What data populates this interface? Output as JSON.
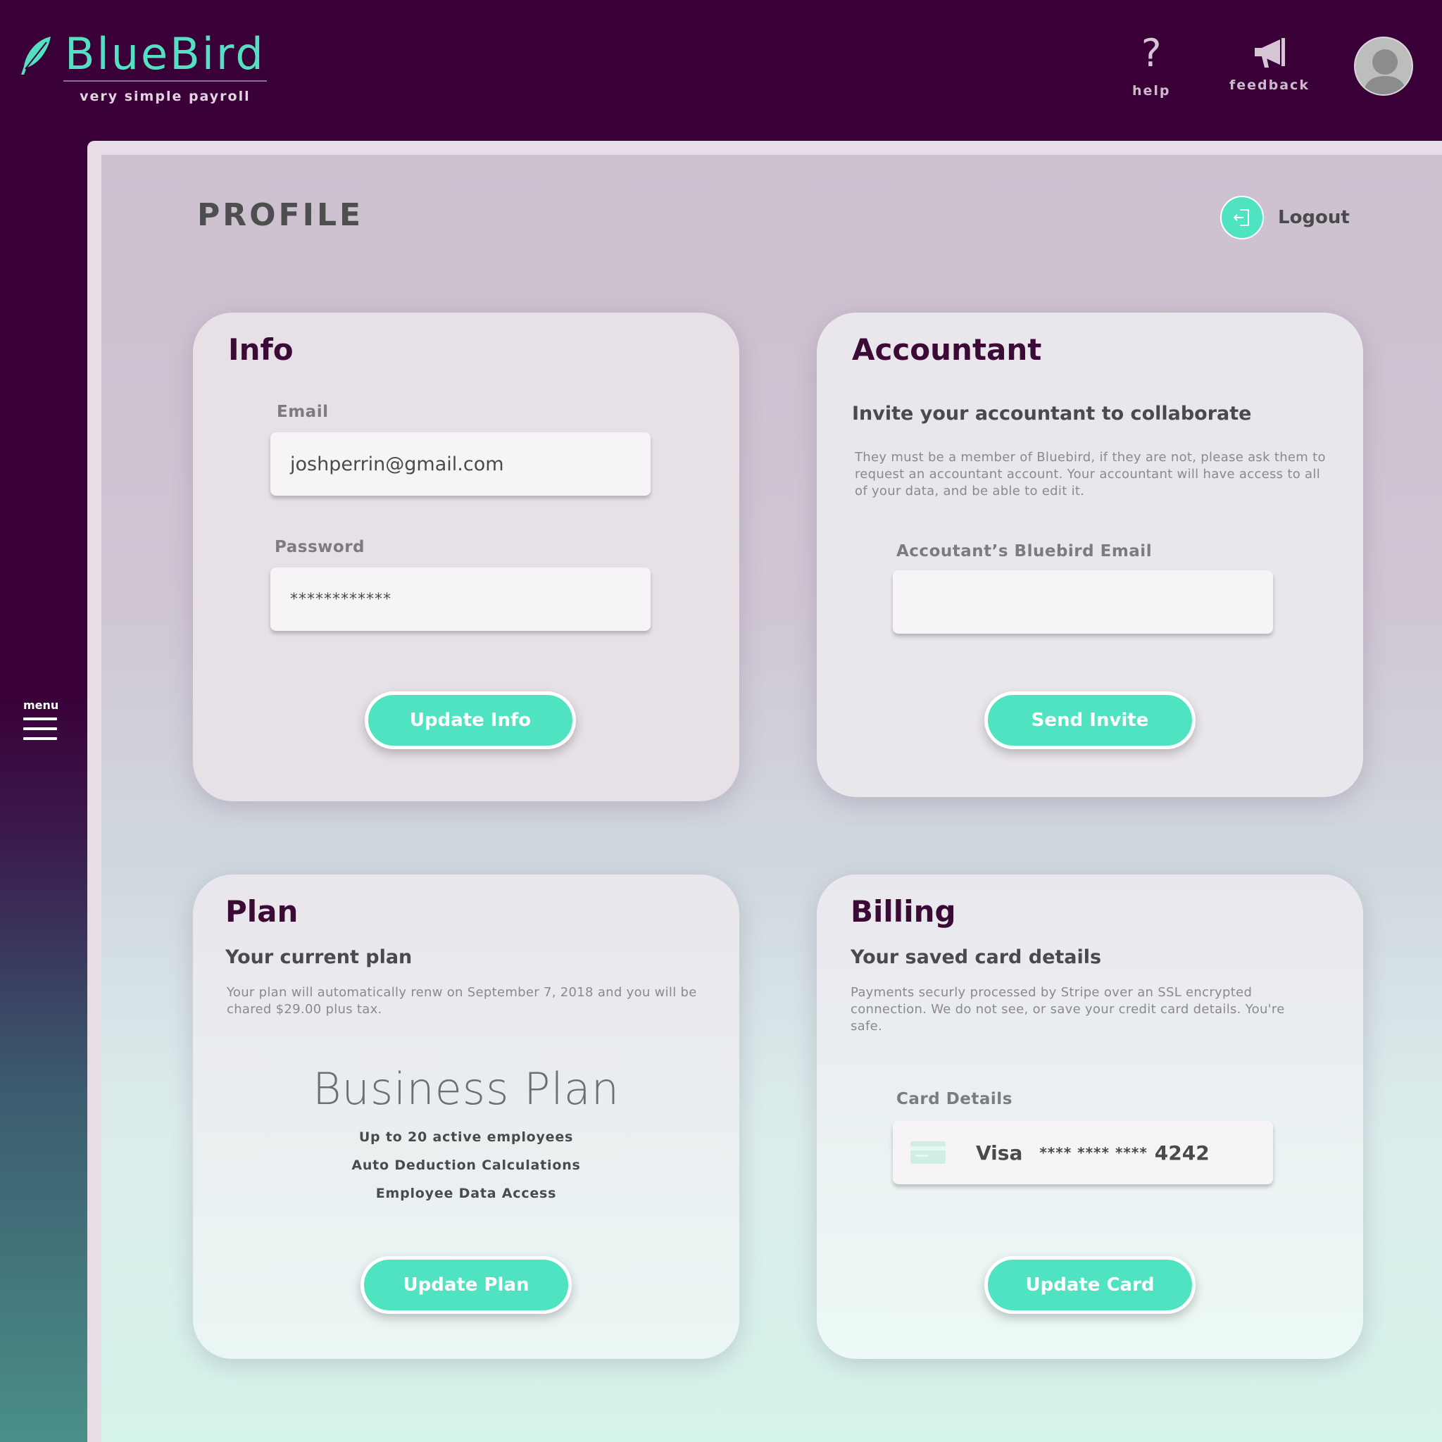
{
  "header": {
    "brand": "BlueBird",
    "tagline": "very simple payroll",
    "help_label": "help",
    "feedback_label": "feedback",
    "help_glyph": "?"
  },
  "sidebar": {
    "menu_label": "menu"
  },
  "page": {
    "title": "PROFILE",
    "logout_label": "Logout"
  },
  "info": {
    "title": "Info",
    "email_label": "Email",
    "email_value": "joshperrin@gmail.com",
    "password_label": "Password",
    "password_value": "************",
    "button": "Update Info"
  },
  "accountant": {
    "title": "Accountant",
    "subtitle": "Invite your accountant to collaborate",
    "description": "They must be a member of Bluebird, if they are not, please ask them to request an accountant account. Your accountant will have access to all of your data, and be able to edit it.",
    "email_label": "Accoutant’s Bluebird Email",
    "email_value": "",
    "button": "Send Invite"
  },
  "plan": {
    "title": "Plan",
    "subtitle": "Your current plan",
    "description": "Your plan will automatically renw on September 7, 2018 and you will be chared $29.00 plus tax.",
    "name": "Business Plan",
    "features": [
      "Up to 20 active employees",
      "Auto Deduction Calculations",
      "Employee Data Access"
    ],
    "button": "Update Plan"
  },
  "billing": {
    "title": "Billing",
    "subtitle": "Your saved card details",
    "description": "Payments securly processed by Stripe over an SSL encrypted connection. We do not see, or save your credit card details. You're safe.",
    "card_label": "Card Details",
    "card_brand": "Visa",
    "card_mask": "**** **** ****",
    "card_last4": "4242",
    "button": "Update Card"
  },
  "colors": {
    "header_bg": "#3a0038",
    "accent": "#4fe3c2",
    "brand_text": "#55e0c3",
    "card_title": "#3b0a36"
  },
  "icons": {
    "logo": "feather-icon",
    "help": "question-icon",
    "feedback": "megaphone-icon",
    "avatar": "user-avatar-icon",
    "menu": "hamburger-icon",
    "logout": "logout-icon",
    "card": "credit-card-icon"
  }
}
